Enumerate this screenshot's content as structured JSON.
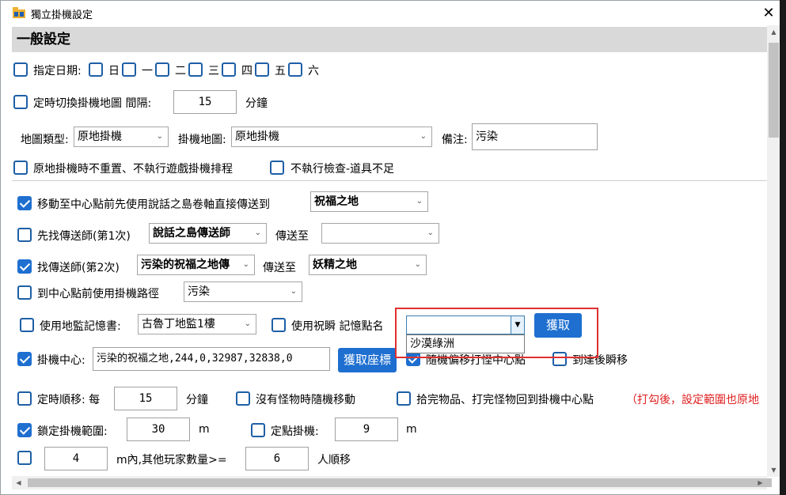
{
  "window": {
    "title": "獨立掛機設定",
    "close_glyph": "✕"
  },
  "section": {
    "title": "一般設定"
  },
  "row_date": {
    "label": "指定日期:",
    "days": [
      "日",
      "一",
      "二",
      "三",
      "四",
      "五",
      "六"
    ]
  },
  "row_switch": {
    "label": "定時切換掛機地圖 間隔:",
    "value": "15",
    "unit": "分鐘"
  },
  "row_map": {
    "map_type_label": "地圖類型:",
    "map_type_value": "原地掛機",
    "map_label": "掛機地圖:",
    "map_value": "原地掛機",
    "note_label": "備注:",
    "note_value": "污染"
  },
  "row_opts": {
    "no_reset_label": "原地掛機時不重置、不執行遊戲掛機排程",
    "no_check_label": "不執行檢查-道具不足"
  },
  "row_teleport": {
    "label": "移動至中心點前先使用說話之島卷軸直接傳送到",
    "value": "祝福之地"
  },
  "row_first": {
    "label": "先找傳送師(第1次)",
    "teleporter": "說話之島傳送師",
    "to_label": "傳送至",
    "to_value": ""
  },
  "row_second": {
    "label": "找傳送師(第2次)",
    "teleporter": "污染的祝福之地傳",
    "to_label": "傳送至",
    "to_value": "妖精之地"
  },
  "row_path": {
    "label": "到中心點前使用掛機路徑",
    "value": "污染"
  },
  "row_memory": {
    "label": "使用地監記憶書:",
    "book_value": "古魯丁地監1樓",
    "bless_label": "使用祝瞬 記憶點名",
    "point_value": "",
    "fetch_button": "獲取",
    "dropdown_option": "沙漠綠洲"
  },
  "row_center": {
    "label": "掛機中心:",
    "value": "污染的祝福之地,244,0,32987,32838,0",
    "fetch_button": "獲取座標",
    "random_label": "隨機偏移打怪中心點",
    "arrive_label": "到達後瞬移"
  },
  "row_timed": {
    "label": "定時順移: 每",
    "value": "15",
    "unit": "分鐘",
    "no_monster_label": "沒有怪物時隨機移動",
    "pickup_label": "拾完物品、打完怪物回到掛機中心點",
    "pickup_note": "（打勾後，設定範圍也原地"
  },
  "row_lock": {
    "label": "鎖定掛機範圍:",
    "value": "30",
    "unit": "m",
    "fixed_label": "定點掛機:",
    "fixed_value": "9",
    "fixed_unit": "m"
  },
  "row_players": {
    "range_value": "4",
    "mid_label": "m內,其他玩家數量>=",
    "count_value": "6",
    "tail_label": "人順移"
  },
  "colors": {
    "accent": "#1e6fd0",
    "header_bg": "#d9d9d9",
    "warning": "#e02020"
  }
}
